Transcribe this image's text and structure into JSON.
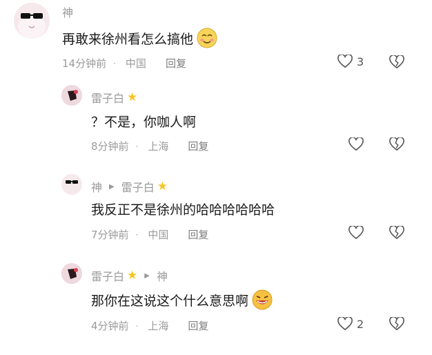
{
  "comments": [
    {
      "username": "神",
      "text": "再敢来徐州看怎么搞他",
      "time": "14分钟前",
      "location": "中国",
      "reply_label": "回复",
      "likes": "3"
    },
    {
      "username": "雷子白",
      "text": "？不是，你咖人啊",
      "time": "8分钟前",
      "location": "上海",
      "reply_label": "回复",
      "likes": ""
    },
    {
      "username": "神",
      "reply_to": "雷子白",
      "text": "我反正不是徐州的哈哈哈哈哈哈",
      "time": "7分钟前",
      "location": "中国",
      "reply_label": "回复",
      "likes": ""
    },
    {
      "username": "雷子白",
      "reply_to": "神",
      "text": "那你在这说这个什么意思啊",
      "time": "4分钟前",
      "location": "上海",
      "reply_label": "回复",
      "likes": "2"
    }
  ],
  "icons": {
    "like": "heart-outline-icon",
    "dislike": "broken-heart-icon",
    "badge": "star-icon",
    "reply_arrow": "triangle-right-icon"
  },
  "colors": {
    "text": "#1a1a1a",
    "muted": "#9a9a9a",
    "star": "#f3c623"
  }
}
